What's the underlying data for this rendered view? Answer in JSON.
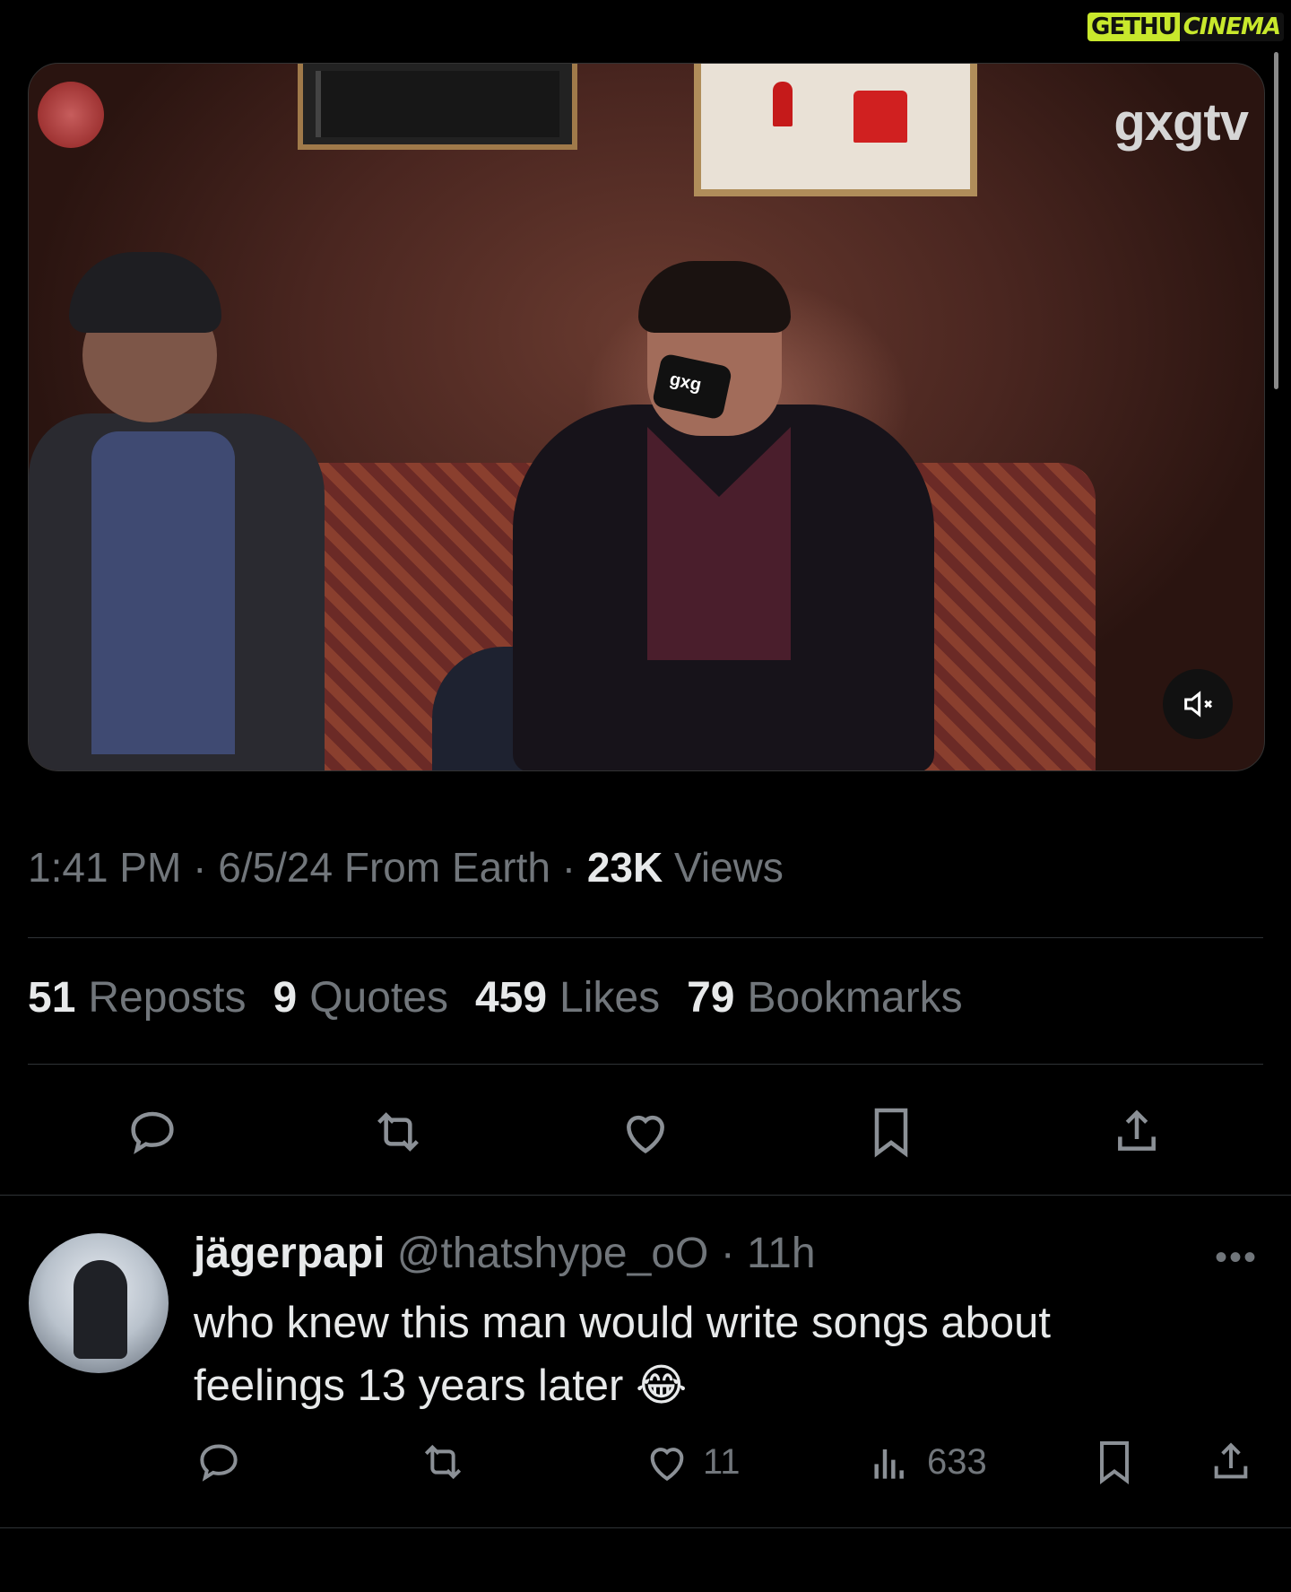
{
  "watermark": {
    "left": "GETHU",
    "right": "CINEMA"
  },
  "video": {
    "channel_logo": "gxgtv",
    "mic_label": "gxg",
    "mute_icon": "speaker-muted-icon"
  },
  "tweet_meta": {
    "time": "1:41 PM",
    "date": "6/5/24",
    "source": "From Earth",
    "views_count": "23K",
    "views_label": "Views"
  },
  "stats": {
    "reposts_count": "51",
    "reposts_label": "Reposts",
    "quotes_count": "9",
    "quotes_label": "Quotes",
    "likes_count": "459",
    "likes_label": "Likes",
    "bookmarks_count": "79",
    "bookmarks_label": "Bookmarks"
  },
  "actions": [
    "reply-icon",
    "repost-icon",
    "like-icon",
    "bookmark-icon",
    "share-icon"
  ],
  "reply": {
    "name": "jägerpapi",
    "handle": "@thatshype_oO",
    "time": "11h",
    "more": "•••",
    "text": "who knew this man would write songs about feelings 13 years later 😂",
    "likes": "11",
    "views": "633"
  },
  "colors": {
    "background": "#000000",
    "text": "#e7e9ea",
    "muted": "#71767b",
    "divider": "#2f3336"
  }
}
